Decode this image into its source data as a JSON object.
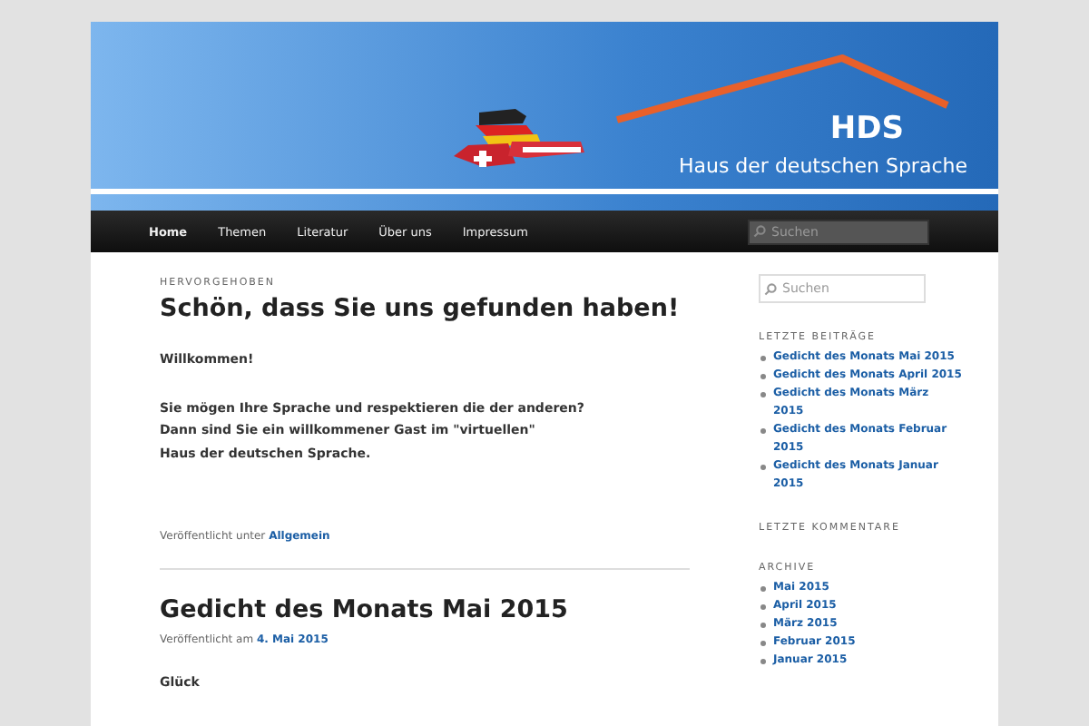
{
  "header": {
    "logo_title": "HDS",
    "logo_subtitle": "Haus der deutschen Sprache"
  },
  "nav": {
    "items": [
      {
        "label": "Home",
        "selected": true
      },
      {
        "label": "Themen",
        "selected": false
      },
      {
        "label": "Literatur",
        "selected": false
      },
      {
        "label": "Über uns",
        "selected": false
      },
      {
        "label": "Impressum",
        "selected": false
      }
    ],
    "search": {
      "placeholder": "Suchen"
    }
  },
  "posts": [
    {
      "kicker": "HERVORGEHOBEN",
      "title": "Schön, dass Sie uns gefunden haben!",
      "paragraphs": [
        "Willkommen!",
        "Sie mögen Ihre Sprache und respektieren die der anderen?\nDann sind Sie ein willkommener Gast im \"virtuellen\"\nHaus der deutschen Sprache."
      ],
      "footer": {
        "text": "Veröffentlicht unter",
        "link": "Allgemein"
      }
    },
    {
      "title": "Gedicht des Monats Mai 2015",
      "meta": {
        "text": "Veröffentlicht am",
        "link": "4. Mai 2015"
      },
      "paragraphs": [
        "Glück"
      ]
    }
  ],
  "sidebar": {
    "search": {
      "placeholder": "Suchen"
    },
    "widgets": [
      {
        "title": "LETZTE BEITRÄGE",
        "items": [
          "Gedicht des Monats Mai 2015",
          "Gedicht des Monats April 2015",
          "Gedicht des Monats März 2015",
          "Gedicht des Monats Februar 2015",
          "Gedicht des Monats Januar 2015"
        ]
      },
      {
        "title": "LETZTE KOMMENTARE"
      },
      {
        "title": "ARCHIVE",
        "items": [
          "Mai 2015",
          "April 2015",
          "März 2015",
          "Februar 2015",
          "Januar 2015"
        ]
      }
    ]
  }
}
